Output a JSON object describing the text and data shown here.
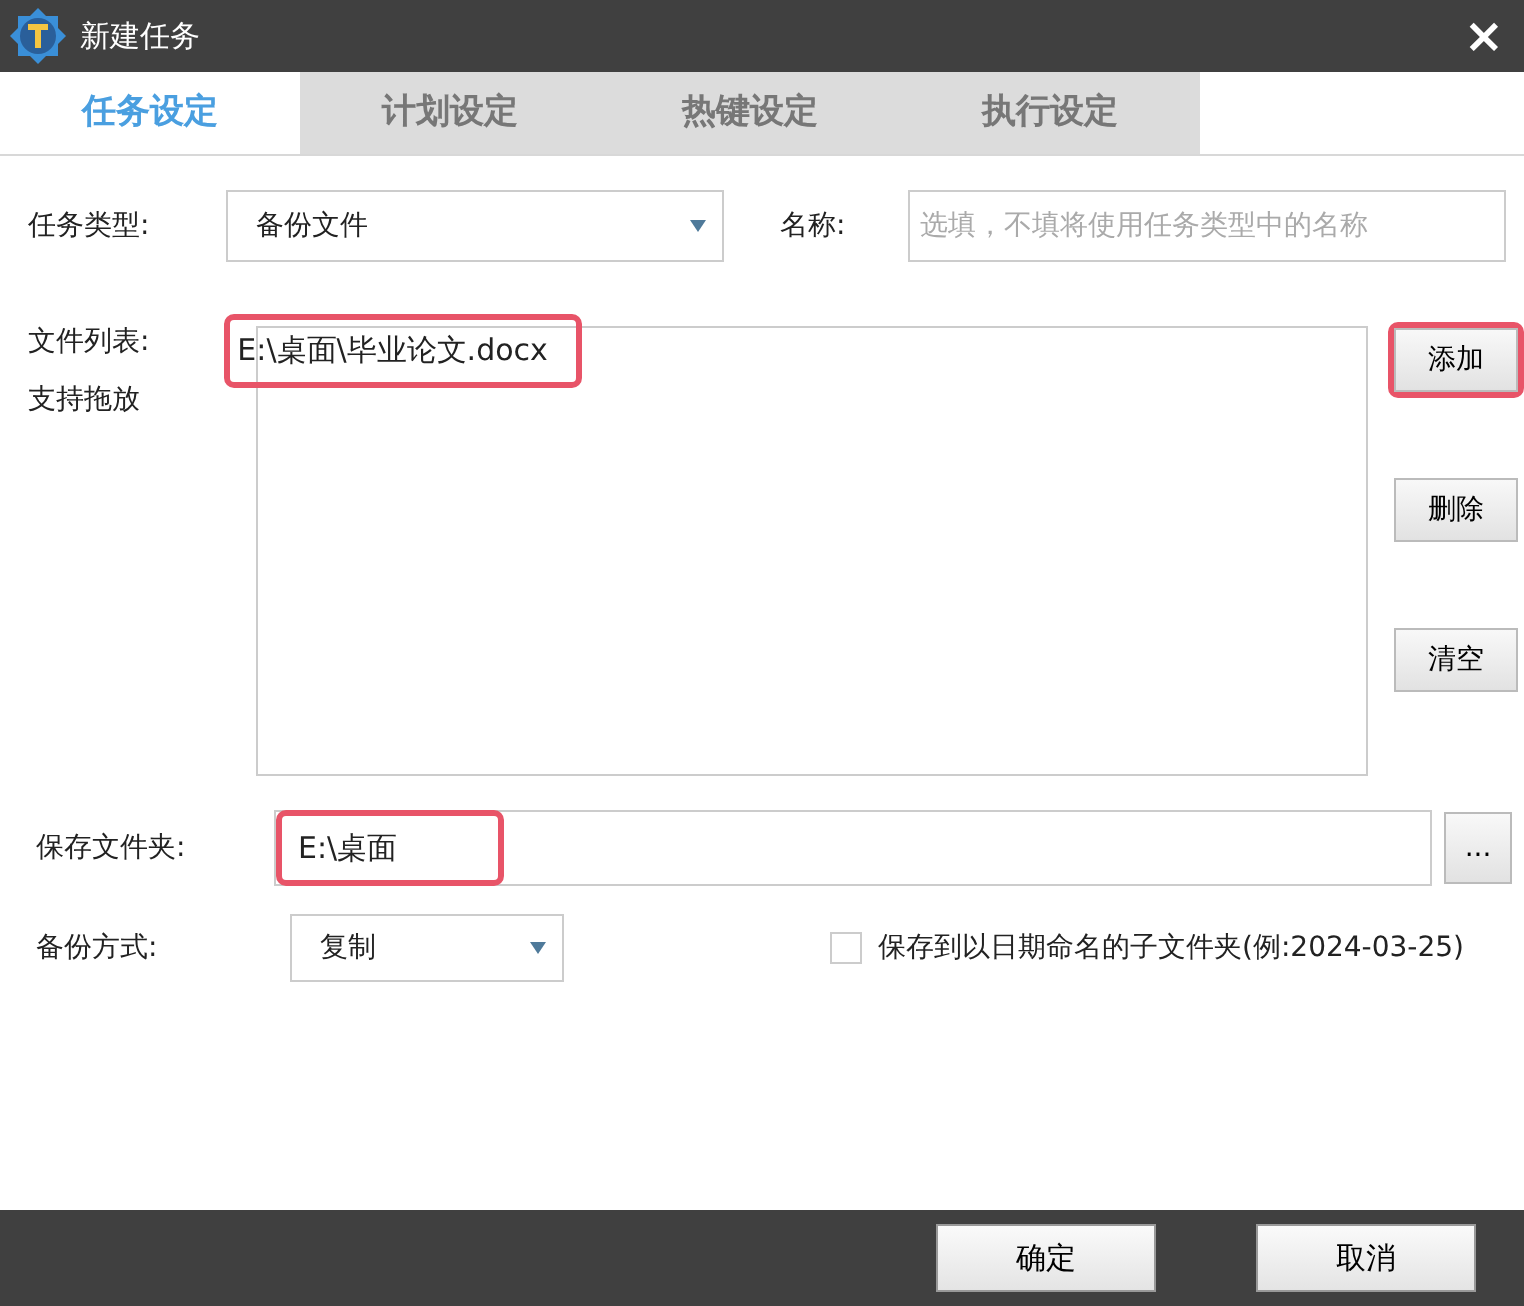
{
  "window": {
    "title": "新建任务",
    "close": "×"
  },
  "tabs": [
    {
      "label": "任务设定",
      "selected": true
    },
    {
      "label": "计划设定",
      "selected": false
    },
    {
      "label": "热键设定",
      "selected": false
    },
    {
      "label": "执行设定",
      "selected": false
    }
  ],
  "task_type": {
    "label": "任务类型:",
    "value": "备份文件"
  },
  "name": {
    "label": "名称:",
    "placeholder": "选填，不填将使用任务类型中的名称"
  },
  "file_list": {
    "label": "文件列表:",
    "hint": "支持拖放",
    "items": [
      {
        "path": "E:\\桌面\\毕业论文.docx",
        "highlighted": true
      }
    ]
  },
  "list_buttons": [
    {
      "label": "添加",
      "highlighted": true
    },
    {
      "label": "删除",
      "highlighted": false
    },
    {
      "label": "清空",
      "highlighted": false
    }
  ],
  "save_folder": {
    "label": "保存文件夹:",
    "value": "E:\\桌面",
    "highlighted": true,
    "browse": "..."
  },
  "backup_mode": {
    "label": "备份方式:",
    "value": "复制"
  },
  "date_subfolder": {
    "label": "保存到以日期命名的子文件夹(例:2024-03-25)",
    "checked": false
  },
  "footer_buttons": [
    "确定",
    "取消"
  ]
}
